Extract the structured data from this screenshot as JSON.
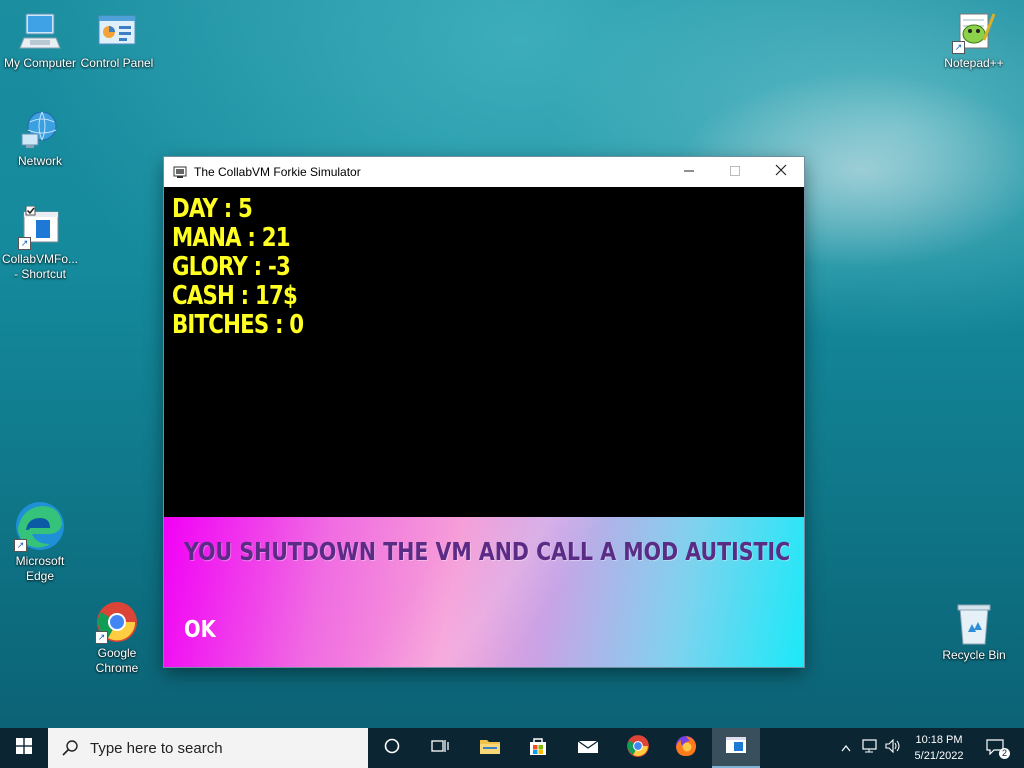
{
  "desktop": {
    "icons": [
      {
        "label": "My Computer"
      },
      {
        "label": "Control Panel"
      },
      {
        "label": "Network"
      },
      {
        "label": "CollabVMFo... - Shortcut"
      },
      {
        "label": "Microsoft Edge"
      },
      {
        "label": "Google Chrome"
      },
      {
        "label": "Notepad++"
      },
      {
        "label": "Recycle Bin"
      }
    ]
  },
  "window": {
    "title": "The CollabVM Forkie Simulator",
    "stats": {
      "day": "DAY : 5",
      "mana": "MANA : 21",
      "glory": "GLORY : -3",
      "cash": "CASH : 17$",
      "bitches": "BITCHES : 0"
    },
    "dialog": {
      "message": "YOU SHUTDOWN THE VM AND CALL A MOD AUTISTIC",
      "ok_label": "OK"
    }
  },
  "taskbar": {
    "search_placeholder": "Type here to search",
    "time": "10:18 PM",
    "date": "5/21/2022",
    "notification_count": "2"
  },
  "colors": {
    "stat_text": "#ffff22",
    "dialog_text": "#5b2c86",
    "taskbar": "#0b2533"
  }
}
